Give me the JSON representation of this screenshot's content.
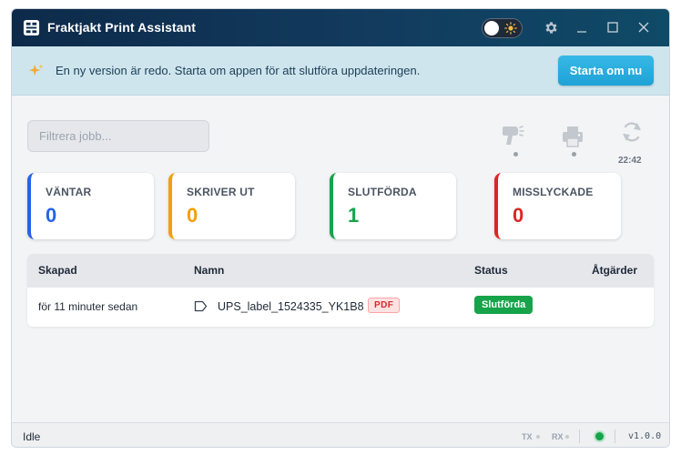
{
  "window": {
    "title": "Fraktjakt Print Assistant"
  },
  "colors": {
    "accent": "#1ea2d6",
    "waiting": "#2563eb",
    "printing": "#f59e0b",
    "done": "#16a34a",
    "failed": "#dc2626"
  },
  "banner": {
    "message": "En ny version är redo. Starta om appen för att slutföra uppdateringen.",
    "restart_label": "Starta om nu"
  },
  "filter": {
    "placeholder": "Filtrera jobb..."
  },
  "toolbar": {
    "last_sync": "22:42"
  },
  "stats": [
    {
      "label": "VÄNTAR",
      "value": "0"
    },
    {
      "label": "SKRIVER UT",
      "value": "0"
    },
    {
      "label": "SLUTFÖRDA",
      "value": "1"
    },
    {
      "label": "MISSLYCKADE",
      "value": "0"
    }
  ],
  "table": {
    "columns": [
      "Skapad",
      "Namn",
      "Status",
      "Åtgärder"
    ],
    "rows": [
      {
        "created": "för 11 minuter sedan",
        "name": "UPS_label_1524335_YK1B8",
        "type": "PDF",
        "status": "Slutförda"
      }
    ]
  },
  "statusbar": {
    "state": "Idle",
    "tx": "TX",
    "rx": "RX",
    "version": "v1.0.0"
  }
}
